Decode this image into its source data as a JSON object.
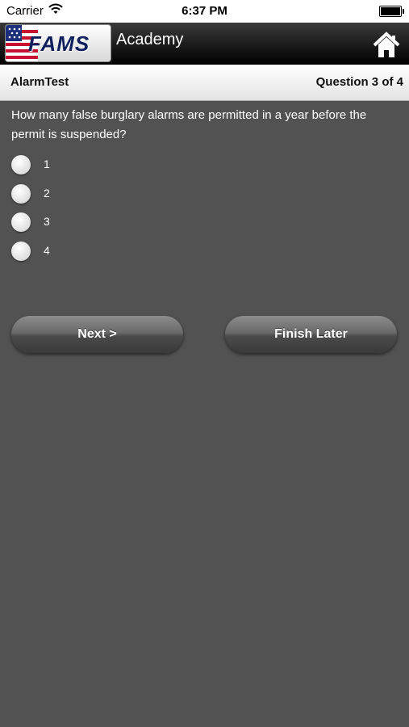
{
  "status_bar": {
    "carrier": "Carrier",
    "time": "6:37 PM"
  },
  "header": {
    "logo_text": "FAMS",
    "title": "Academy",
    "home_icon": "home-icon"
  },
  "sub_header": {
    "quiz_name": "AlarmTest",
    "question_counter": "Question 3 of 4"
  },
  "question": {
    "text": "How many false burglary alarms are permitted in a year before the permit is suspended?",
    "options": [
      "1",
      "2",
      "3",
      "4"
    ]
  },
  "actions": {
    "next_label": "Next >",
    "finish_later_label": "Finish Later"
  },
  "colors": {
    "background": "#525252",
    "header": "#000000",
    "logo_text": "#0f1f5e"
  }
}
